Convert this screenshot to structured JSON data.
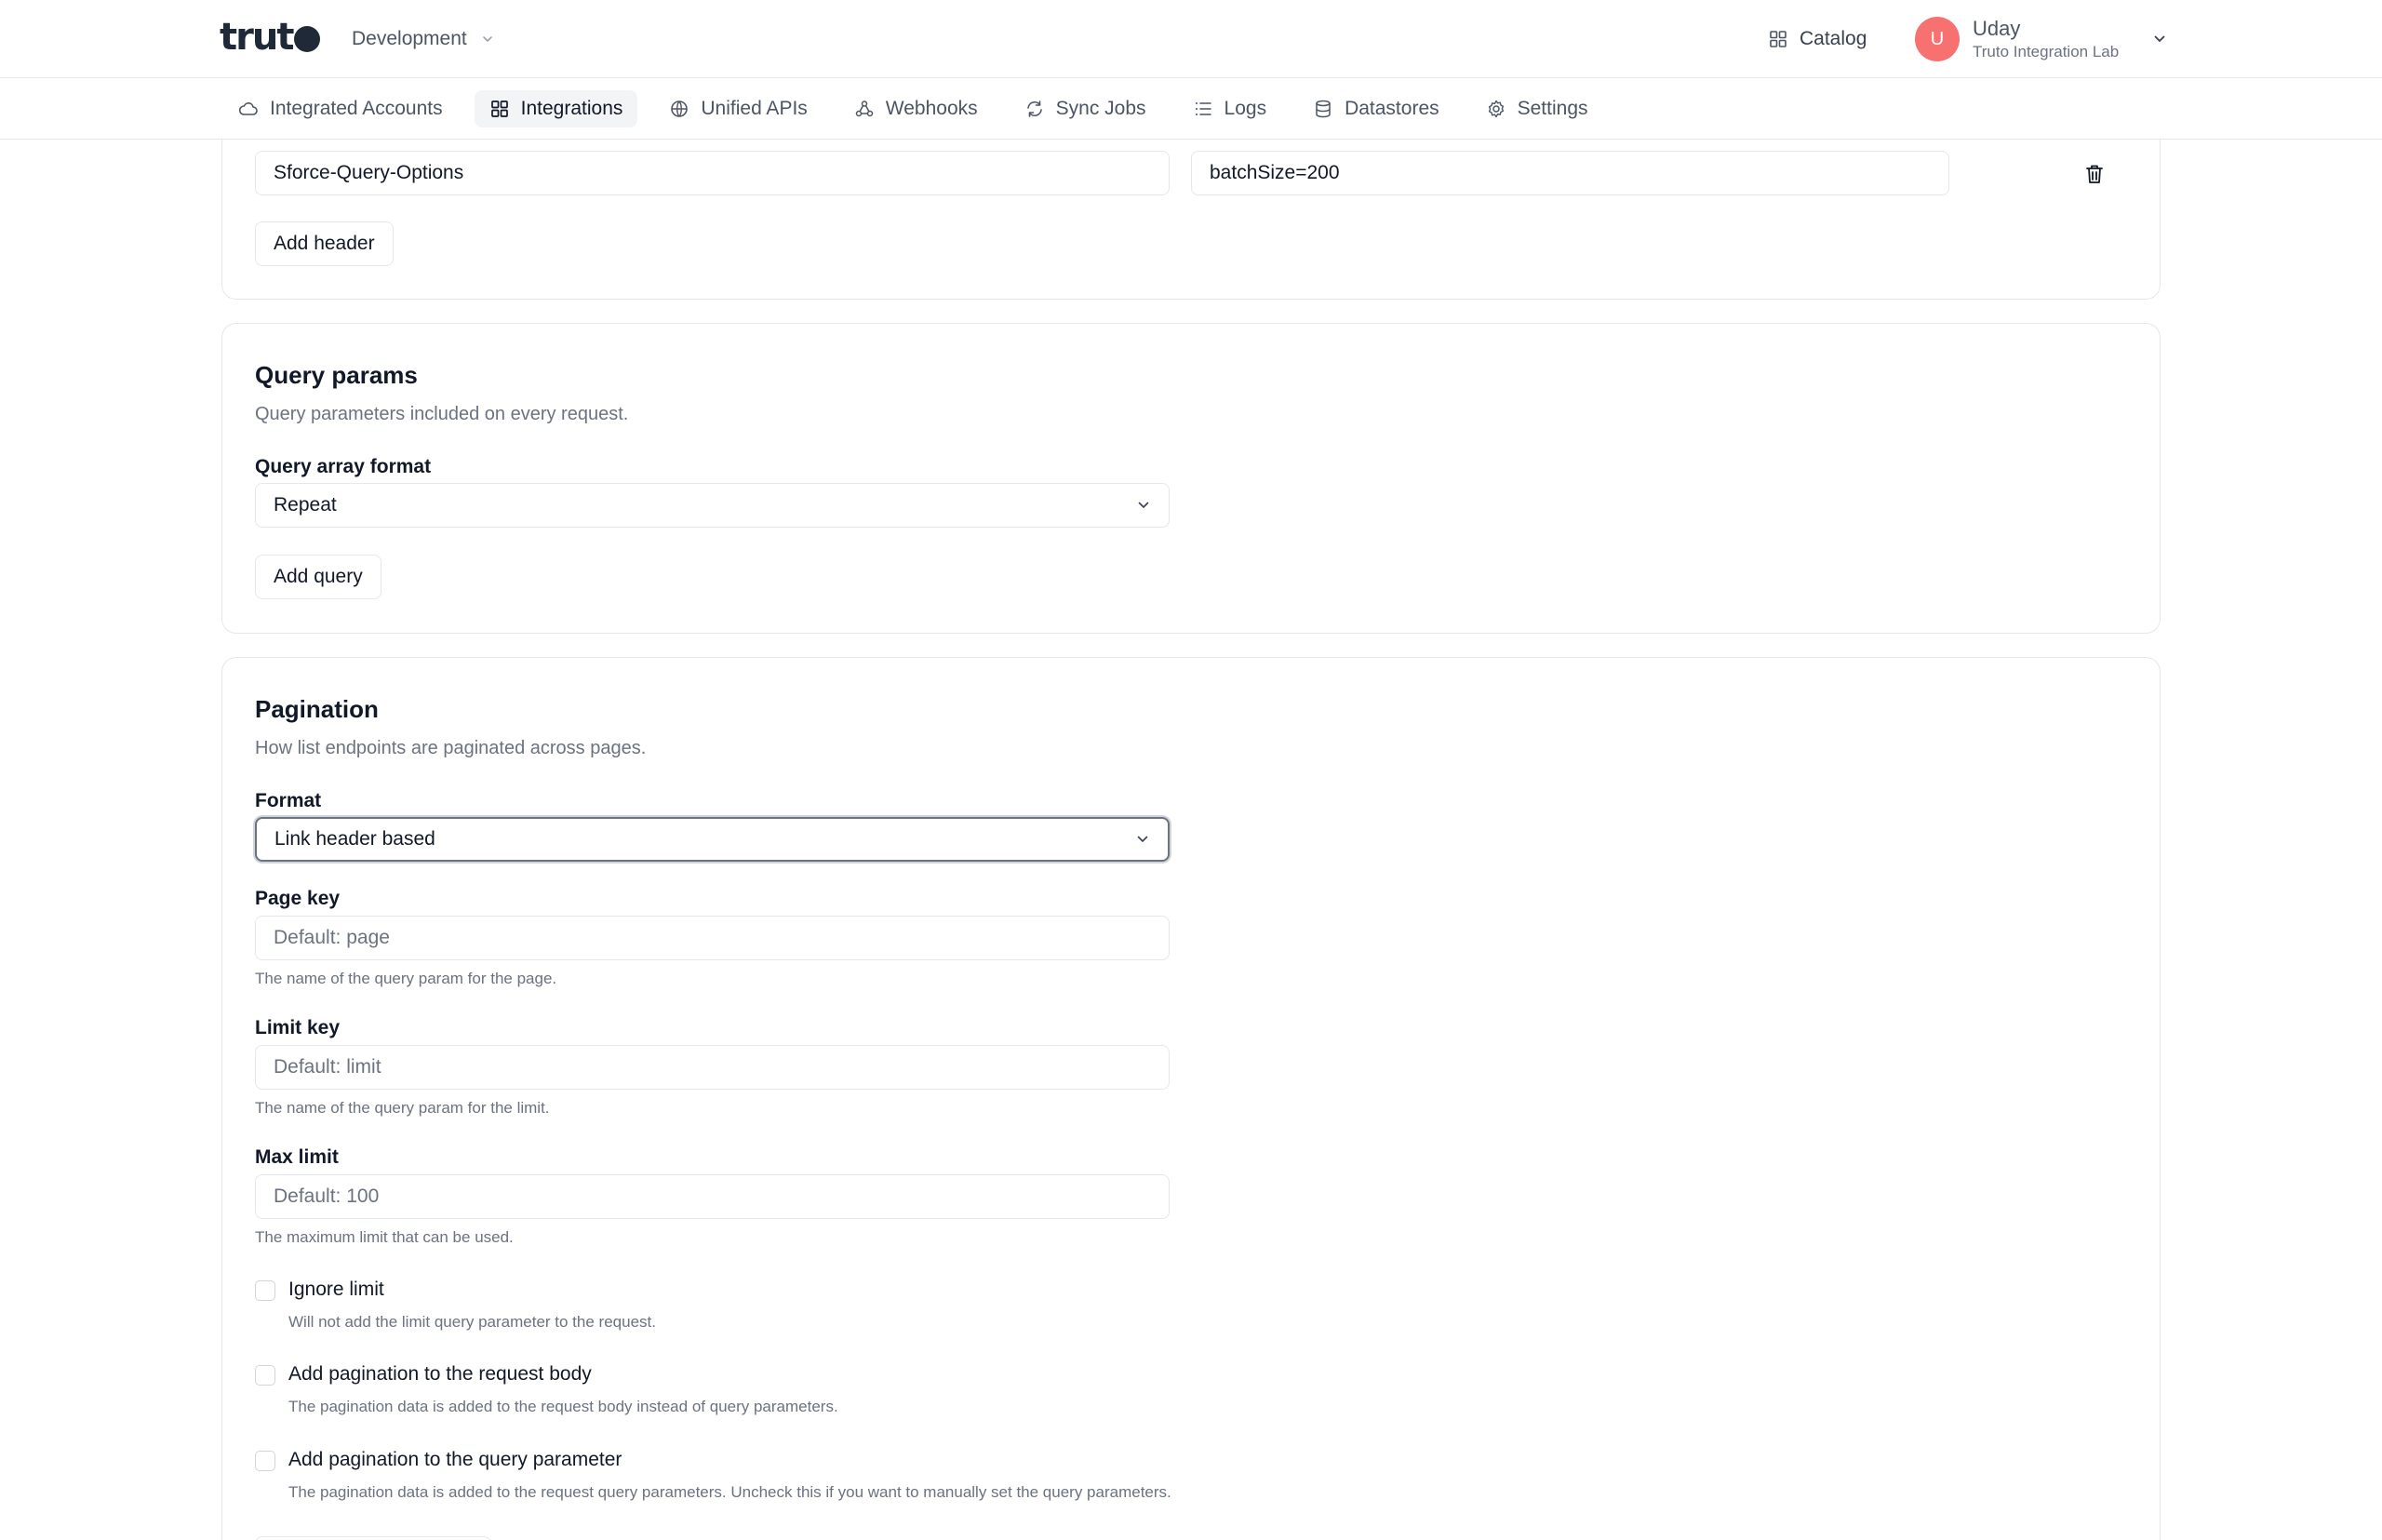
{
  "app": {
    "logo_text": "trut",
    "environment": "Development"
  },
  "header": {
    "catalog_label": "Catalog",
    "user": {
      "initial": "U",
      "name": "Uday",
      "org": "Truto Integration Lab"
    }
  },
  "nav": {
    "items": [
      {
        "label": "Integrated Accounts",
        "icon": "cloud-icon"
      },
      {
        "label": "Integrations",
        "icon": "grid-icon",
        "active": true
      },
      {
        "label": "Unified APIs",
        "icon": "globe-icon"
      },
      {
        "label": "Webhooks",
        "icon": "webhook-icon"
      },
      {
        "label": "Sync Jobs",
        "icon": "sync-icon"
      },
      {
        "label": "Logs",
        "icon": "list-icon"
      },
      {
        "label": "Datastores",
        "icon": "database-icon"
      },
      {
        "label": "Settings",
        "icon": "gear-icon"
      }
    ]
  },
  "headers_section": {
    "header_row": {
      "key": "Sforce-Query-Options",
      "value": "batchSize=200"
    },
    "add_header_label": "Add header"
  },
  "query_params": {
    "title": "Query params",
    "subtitle": "Query parameters included on every request.",
    "array_format_label": "Query array format",
    "array_format_value": "Repeat",
    "add_query_label": "Add query"
  },
  "pagination": {
    "title": "Pagination",
    "subtitle": "How list endpoints are paginated across pages.",
    "format_label": "Format",
    "format_value": "Link header based",
    "page_key": {
      "label": "Page key",
      "placeholder": "Default: page",
      "hint": "The name of the query param for the page."
    },
    "limit_key": {
      "label": "Limit key",
      "placeholder": "Default: limit",
      "hint": "The name of the query param for the limit."
    },
    "max_limit": {
      "label": "Max limit",
      "placeholder": "Default: 100",
      "hint": "The maximum limit that can be used."
    },
    "ignore_limit": {
      "label": "Ignore limit",
      "hint": "Will not add the limit query parameter to the request.",
      "checked": false
    },
    "add_to_body": {
      "label": "Add pagination to the request body",
      "hint": "The pagination data is added to the request body instead of query parameters.",
      "checked": false
    },
    "add_to_query": {
      "label": "Add pagination to the query parameter",
      "hint": "The pagination data is added to the request query parameters. Uncheck this if you want to manually set the query parameters.",
      "checked": false
    }
  },
  "colors": {
    "avatar": "#f87171",
    "border": "#e5e7eb",
    "muted_text": "#6b7280"
  }
}
